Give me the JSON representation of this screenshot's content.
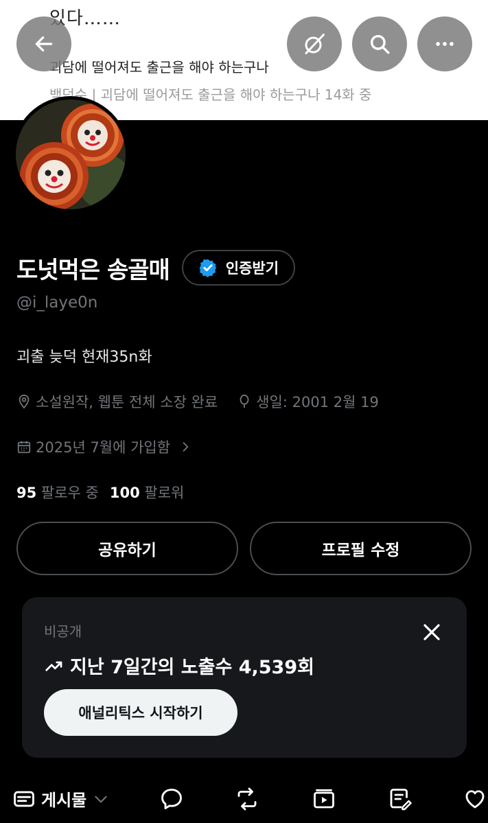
{
  "banner": {
    "line1": "있다……",
    "line2": "괴담에 떨어져도 출근을 해야 하는구나",
    "line3": "백덕수 | 괴담에 떨어져도 출근을 해야 하는구나 14화 중"
  },
  "profile": {
    "display_name": "도넛먹은 송골매",
    "verify_label": "인증받기",
    "handle": "@i_laye0n",
    "bio": "괴출 늦덕 현재35n화",
    "location": "소설원작, 웹툰 전체 소장 완료",
    "birthday": "생일: 2001 2월 19",
    "joined": "2025년 7월에 가입함",
    "following_count": "95",
    "following_label": "팔로우 중",
    "followers_count": "100",
    "followers_label": "팔로워"
  },
  "actions": {
    "share_label": "공유하기",
    "edit_label": "프로필 수정"
  },
  "analytics_card": {
    "visibility": "비공개",
    "stat_text": "지난 7일간의 노출수 4,539회",
    "cta_label": "애널리틱스 시작하기"
  },
  "tabs": {
    "posts_label": "게시물"
  },
  "colors": {
    "verified_badge": "#1d9bf0",
    "background": "#000000",
    "muted_text": "#71767b"
  }
}
